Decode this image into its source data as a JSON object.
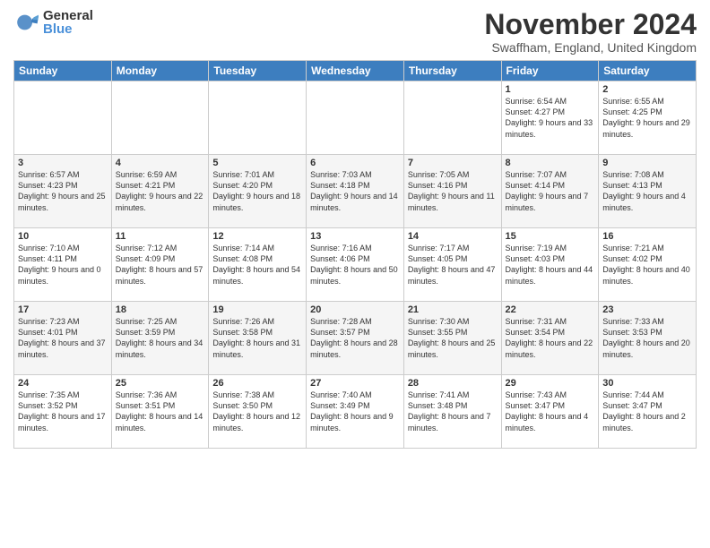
{
  "logo": {
    "general": "General",
    "blue": "Blue"
  },
  "title": "November 2024",
  "location": "Swaffham, England, United Kingdom",
  "days_of_week": [
    "Sunday",
    "Monday",
    "Tuesday",
    "Wednesday",
    "Thursday",
    "Friday",
    "Saturday"
  ],
  "weeks": [
    [
      {
        "day": "",
        "info": ""
      },
      {
        "day": "",
        "info": ""
      },
      {
        "day": "",
        "info": ""
      },
      {
        "day": "",
        "info": ""
      },
      {
        "day": "",
        "info": ""
      },
      {
        "day": "1",
        "info": "Sunrise: 6:54 AM\nSunset: 4:27 PM\nDaylight: 9 hours\nand 33 minutes."
      },
      {
        "day": "2",
        "info": "Sunrise: 6:55 AM\nSunset: 4:25 PM\nDaylight: 9 hours\nand 29 minutes."
      }
    ],
    [
      {
        "day": "3",
        "info": "Sunrise: 6:57 AM\nSunset: 4:23 PM\nDaylight: 9 hours\nand 25 minutes."
      },
      {
        "day": "4",
        "info": "Sunrise: 6:59 AM\nSunset: 4:21 PM\nDaylight: 9 hours\nand 22 minutes."
      },
      {
        "day": "5",
        "info": "Sunrise: 7:01 AM\nSunset: 4:20 PM\nDaylight: 9 hours\nand 18 minutes."
      },
      {
        "day": "6",
        "info": "Sunrise: 7:03 AM\nSunset: 4:18 PM\nDaylight: 9 hours\nand 14 minutes."
      },
      {
        "day": "7",
        "info": "Sunrise: 7:05 AM\nSunset: 4:16 PM\nDaylight: 9 hours\nand 11 minutes."
      },
      {
        "day": "8",
        "info": "Sunrise: 7:07 AM\nSunset: 4:14 PM\nDaylight: 9 hours\nand 7 minutes."
      },
      {
        "day": "9",
        "info": "Sunrise: 7:08 AM\nSunset: 4:13 PM\nDaylight: 9 hours\nand 4 minutes."
      }
    ],
    [
      {
        "day": "10",
        "info": "Sunrise: 7:10 AM\nSunset: 4:11 PM\nDaylight: 9 hours\nand 0 minutes."
      },
      {
        "day": "11",
        "info": "Sunrise: 7:12 AM\nSunset: 4:09 PM\nDaylight: 8 hours\nand 57 minutes."
      },
      {
        "day": "12",
        "info": "Sunrise: 7:14 AM\nSunset: 4:08 PM\nDaylight: 8 hours\nand 54 minutes."
      },
      {
        "day": "13",
        "info": "Sunrise: 7:16 AM\nSunset: 4:06 PM\nDaylight: 8 hours\nand 50 minutes."
      },
      {
        "day": "14",
        "info": "Sunrise: 7:17 AM\nSunset: 4:05 PM\nDaylight: 8 hours\nand 47 minutes."
      },
      {
        "day": "15",
        "info": "Sunrise: 7:19 AM\nSunset: 4:03 PM\nDaylight: 8 hours\nand 44 minutes."
      },
      {
        "day": "16",
        "info": "Sunrise: 7:21 AM\nSunset: 4:02 PM\nDaylight: 8 hours\nand 40 minutes."
      }
    ],
    [
      {
        "day": "17",
        "info": "Sunrise: 7:23 AM\nSunset: 4:01 PM\nDaylight: 8 hours\nand 37 minutes."
      },
      {
        "day": "18",
        "info": "Sunrise: 7:25 AM\nSunset: 3:59 PM\nDaylight: 8 hours\nand 34 minutes."
      },
      {
        "day": "19",
        "info": "Sunrise: 7:26 AM\nSunset: 3:58 PM\nDaylight: 8 hours\nand 31 minutes."
      },
      {
        "day": "20",
        "info": "Sunrise: 7:28 AM\nSunset: 3:57 PM\nDaylight: 8 hours\nand 28 minutes."
      },
      {
        "day": "21",
        "info": "Sunrise: 7:30 AM\nSunset: 3:55 PM\nDaylight: 8 hours\nand 25 minutes."
      },
      {
        "day": "22",
        "info": "Sunrise: 7:31 AM\nSunset: 3:54 PM\nDaylight: 8 hours\nand 22 minutes."
      },
      {
        "day": "23",
        "info": "Sunrise: 7:33 AM\nSunset: 3:53 PM\nDaylight: 8 hours\nand 20 minutes."
      }
    ],
    [
      {
        "day": "24",
        "info": "Sunrise: 7:35 AM\nSunset: 3:52 PM\nDaylight: 8 hours\nand 17 minutes."
      },
      {
        "day": "25",
        "info": "Sunrise: 7:36 AM\nSunset: 3:51 PM\nDaylight: 8 hours\nand 14 minutes."
      },
      {
        "day": "26",
        "info": "Sunrise: 7:38 AM\nSunset: 3:50 PM\nDaylight: 8 hours\nand 12 minutes."
      },
      {
        "day": "27",
        "info": "Sunrise: 7:40 AM\nSunset: 3:49 PM\nDaylight: 8 hours\nand 9 minutes."
      },
      {
        "day": "28",
        "info": "Sunrise: 7:41 AM\nSunset: 3:48 PM\nDaylight: 8 hours\nand 7 minutes."
      },
      {
        "day": "29",
        "info": "Sunrise: 7:43 AM\nSunset: 3:47 PM\nDaylight: 8 hours\nand 4 minutes."
      },
      {
        "day": "30",
        "info": "Sunrise: 7:44 AM\nSunset: 3:47 PM\nDaylight: 8 hours\nand 2 minutes."
      }
    ]
  ]
}
